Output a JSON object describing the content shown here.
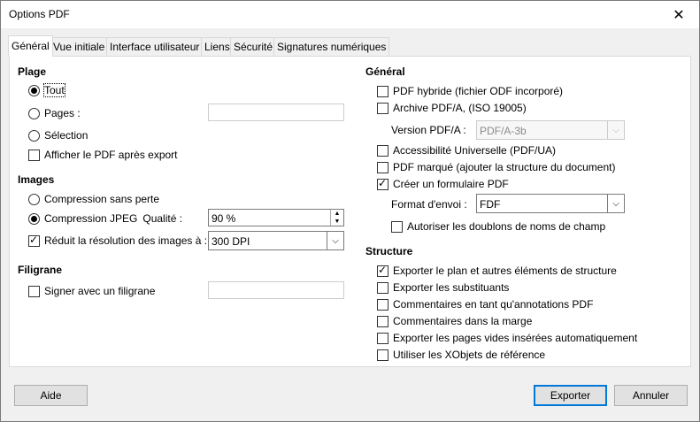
{
  "window": {
    "title": "Options PDF",
    "close_glyph": "✕"
  },
  "tabs": [
    "Général",
    "Vue initiale",
    "Interface utilisateur",
    "Liens",
    "Sécurité",
    "Signatures numériques"
  ],
  "plage": {
    "heading": "Plage",
    "tout": "Tout",
    "pages": "Pages :",
    "pages_value": "",
    "selection": "Sélection",
    "afficher": "Afficher le PDF après export"
  },
  "images": {
    "heading": "Images",
    "sans_perte": "Compression sans perte",
    "jpeg": "Compression JPEG",
    "qualite_label": "Qualité :",
    "qualite_value": "90 %",
    "reduit": "Réduit la résolution des images à :",
    "resolution_value": "300 DPI"
  },
  "filigrane": {
    "heading": "Filigrane",
    "signer": "Signer avec un filigrane",
    "value": ""
  },
  "general": {
    "heading": "Général",
    "hybride": "PDF hybride (fichier ODF incorporé)",
    "archive": "Archive PDF/A, (ISO 19005)",
    "version_label": "Version PDF/A :",
    "version_value": "PDF/A-3b",
    "accessibilite": "Accessibilité Universelle (PDF/UA)",
    "marque": "PDF marqué (ajouter la structure du document)",
    "formulaire": "Créer un formulaire PDF",
    "format_label": "Format d'envoi :",
    "format_value": "FDF",
    "doublons": "Autoriser les doublons de noms de champ"
  },
  "structure": {
    "heading": "Structure",
    "plan": "Exporter le plan et autres éléments de structure",
    "substituants": "Exporter les substituants",
    "annotations": "Commentaires en tant qu'annotations PDF",
    "marge": "Commentaires dans la marge",
    "pages_vides": "Exporter les pages vides insérées automatiquement",
    "xobjets": "Utiliser les XObjets de référence"
  },
  "buttons": {
    "aide": "Aide",
    "exporter": "Exporter",
    "annuler": "Annuler"
  }
}
